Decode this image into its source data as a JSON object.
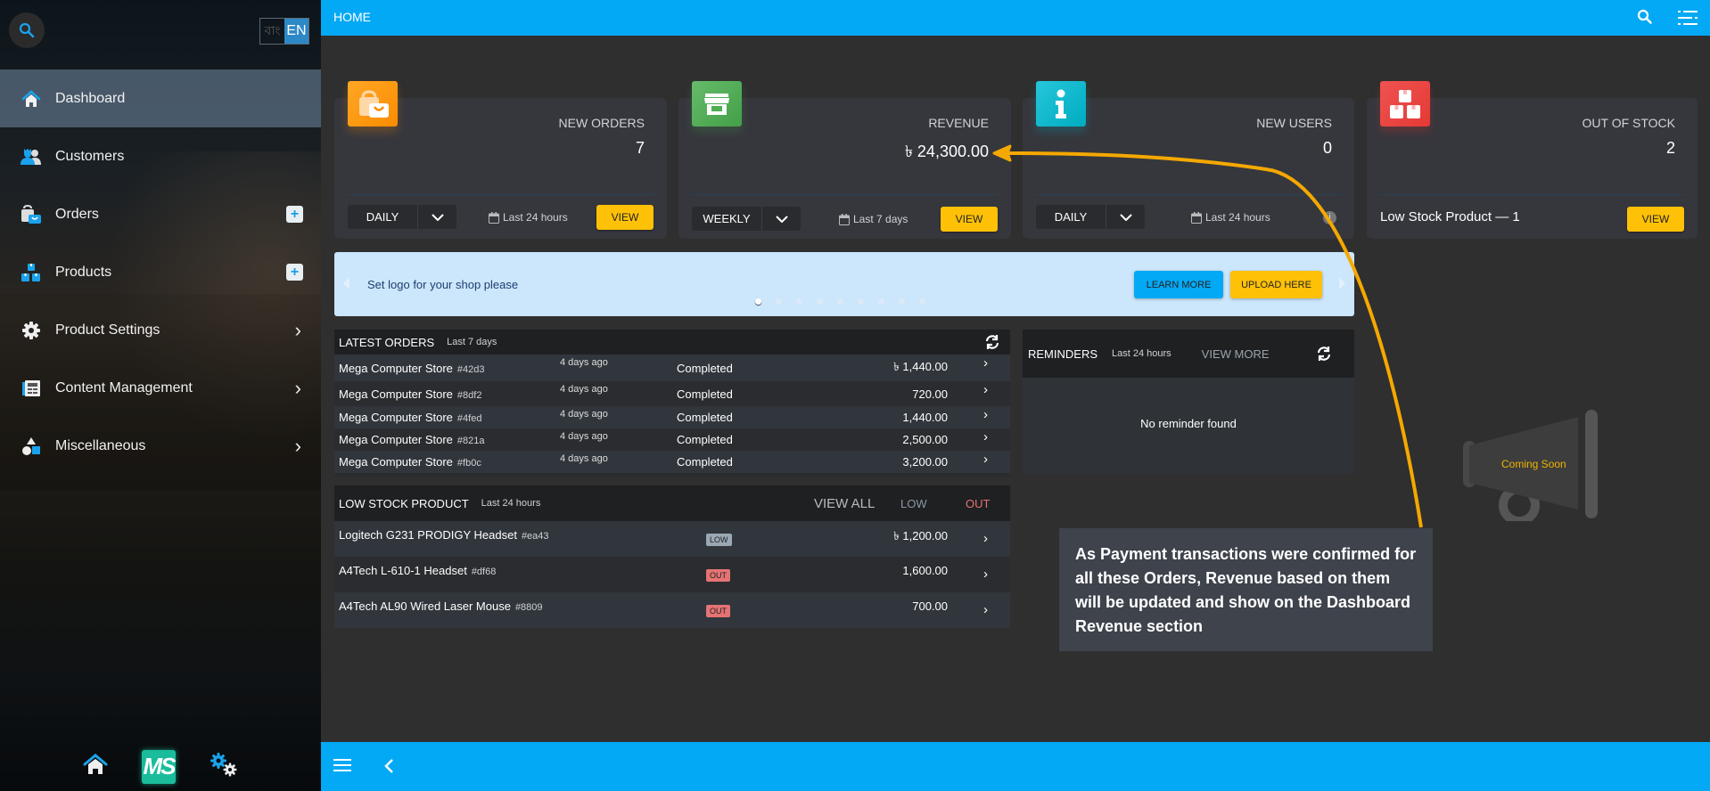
{
  "sidebar": {
    "lang": {
      "bn": "বাং",
      "en": "EN"
    },
    "items": [
      {
        "label": "Dashboard",
        "icon": "home-icon",
        "active": true
      },
      {
        "label": "Customers",
        "icon": "users-icon"
      },
      {
        "label": "Orders",
        "icon": "shopping-bag-icon",
        "action": "plus"
      },
      {
        "label": "Products",
        "icon": "boxes-icon",
        "action": "plus"
      },
      {
        "label": "Product Settings",
        "icon": "gear-icon",
        "action": "chevron"
      },
      {
        "label": "Content Management",
        "icon": "newspaper-icon",
        "action": "chevron"
      },
      {
        "label": "Miscellaneous",
        "icon": "shapes-icon",
        "action": "chevron"
      }
    ],
    "footer": {
      "logo": "MS"
    }
  },
  "header": {
    "title": "HOME"
  },
  "cards": [
    {
      "label": "NEW ORDERS",
      "value": "7",
      "period": "DAILY",
      "range": "Last 24 hours",
      "button": "VIEW",
      "color": "#ff9800"
    },
    {
      "label": "REVENUE",
      "value": "৳  24,300.00",
      "period": "WEEKLY",
      "range": "Last 7 days",
      "button": "VIEW",
      "color": "#4caf50"
    },
    {
      "label": "NEW USERS",
      "value": "0",
      "period": "DAILY",
      "range": "Last 24 hours",
      "color": "#00bcd4"
    },
    {
      "label": "OUT OF STOCK",
      "value": "2",
      "footer_text": "Low Stock Product — 1",
      "button": "VIEW",
      "color": "#e53935"
    }
  ],
  "banner": {
    "message": "Set logo for your shop please",
    "learn_more": "LEARN MORE",
    "upload": "UPLOAD HERE",
    "slides": 9,
    "active_slide": 1
  },
  "latest_orders": {
    "title": "LATEST ORDERS",
    "range": "Last 7 days",
    "rows": [
      {
        "store": "Mega Computer Store",
        "id": "#42d3",
        "ago": "4 days ago",
        "status": "Completed",
        "amount": "৳ 1,440.00"
      },
      {
        "store": "Mega Computer Store",
        "id": "#8df2",
        "ago": "4 days ago",
        "status": "Completed",
        "amount": "720.00"
      },
      {
        "store": "Mega Computer Store",
        "id": "#4fed",
        "ago": "4 days ago",
        "status": "Completed",
        "amount": "1,440.00"
      },
      {
        "store": "Mega Computer Store",
        "id": "#821a",
        "ago": "4 days ago",
        "status": "Completed",
        "amount": "2,500.00"
      },
      {
        "store": "Mega Computer Store",
        "id": "#fb0c",
        "ago": "4 days ago",
        "status": "Completed",
        "amount": "3,200.00"
      }
    ]
  },
  "reminders": {
    "title": "REMINDERS",
    "range": "Last 24 hours",
    "view_more": "VIEW MORE",
    "empty": "No reminder found"
  },
  "low_stock": {
    "title": "LOW STOCK PRODUCT",
    "range": "Last 24 hours",
    "view_all": "VIEW ALL",
    "filter_low": "LOW",
    "filter_out": "OUT",
    "rows": [
      {
        "name": "Logitech G231 PRODIGY Headset",
        "id": "#ea43",
        "badge": "LOW",
        "amount": "৳ 1,200.00"
      },
      {
        "name": "A4Tech L-610-1 Headset",
        "id": "#df68",
        "badge": "OUT",
        "amount": "1,600.00"
      },
      {
        "name": "A4Tech AL90 Wired Laser Mouse",
        "id": "#8809",
        "badge": "OUT",
        "amount": "700.00"
      }
    ]
  },
  "coming_soon": "Coming Soon",
  "annotation": "As Payment transactions were confirmed for all these Orders, Revenue based on them will be updated and show on the Dashboard Revenue section",
  "colors": {
    "accent": "#03a9f4",
    "button": "#ffc107",
    "annotation_arrow": "#f5a800",
    "low_badge": "#9aa8b4",
    "out_badge": "#e57373"
  }
}
